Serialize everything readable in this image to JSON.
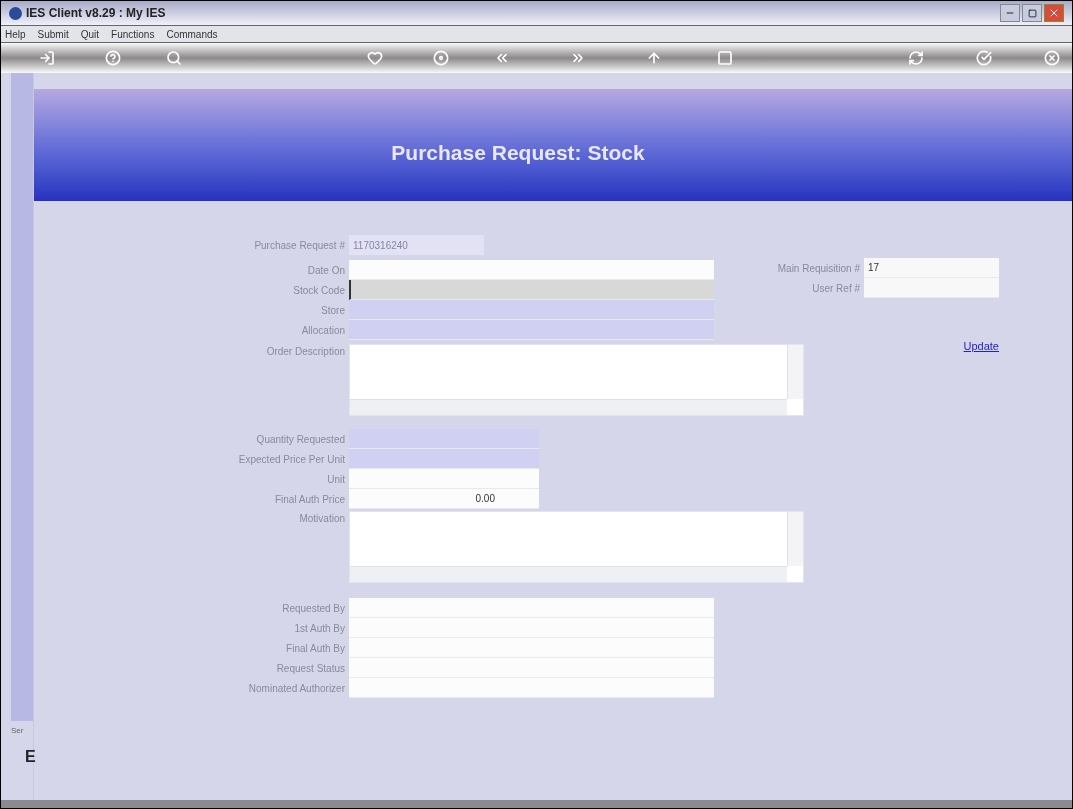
{
  "window": {
    "title": "IES Client v8.29 : My IES"
  },
  "menu": [
    "Help",
    "Submit",
    "Quit",
    "Functions",
    "Commands"
  ],
  "header": {
    "title": "Purchase Request: Stock"
  },
  "request_number": {
    "label": "Purchase Request #",
    "value": "1170316240"
  },
  "right_fields": [
    {
      "label": "Main Requisition #",
      "value": "17"
    },
    {
      "label": "User Ref #"
    }
  ],
  "update_link": "Update",
  "top_fields": [
    {
      "label": "Date On",
      "disabled": false,
      "focused": false
    },
    {
      "label": "Stock Code",
      "disabled": false,
      "focused": true
    },
    {
      "label": "Store",
      "disabled": true,
      "focused": false
    },
    {
      "label": "Allocation",
      "disabled": true,
      "focused": false
    }
  ],
  "order_description": {
    "label": "Order Description"
  },
  "price_fields": [
    {
      "label": "Quantity Requested",
      "disabled": true
    },
    {
      "label": "Expected Price Per Unit",
      "disabled": true
    },
    {
      "label": "Unit",
      "disabled": false
    },
    {
      "label": "Final Auth Price",
      "value": "0.00",
      "disabled": false
    }
  ],
  "motivation": {
    "label": "Motivation"
  },
  "bottom_fields": [
    {
      "label": "Requested By"
    },
    {
      "label": "1st Auth By"
    },
    {
      "label": "Final Auth By"
    },
    {
      "label": "Request Status"
    },
    {
      "label": "Nominated Authorizer"
    }
  ],
  "side_panel": {
    "label": "Ser",
    "letter": "E"
  }
}
